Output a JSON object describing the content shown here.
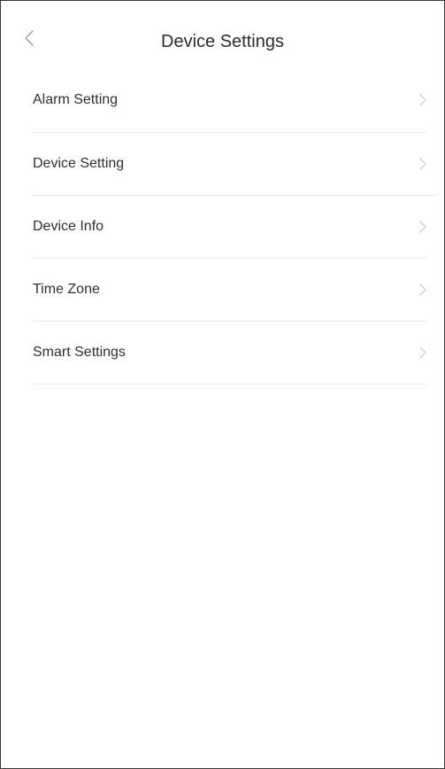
{
  "header": {
    "back_icon": "chevron-left-icon",
    "title": "Device Settings"
  },
  "settings": {
    "items": [
      {
        "label": "Alarm Setting",
        "icon": "chevron-right-icon"
      },
      {
        "label": "Device Setting",
        "icon": "chevron-right-icon"
      },
      {
        "label": "Device Info",
        "icon": "chevron-right-icon"
      },
      {
        "label": "Time Zone",
        "icon": "chevron-right-icon"
      },
      {
        "label": "Smart Settings",
        "icon": "chevron-right-icon"
      }
    ]
  },
  "colors": {
    "background": "#ffffff",
    "text": "#2f2f2f",
    "divider": "#ececec",
    "chevron": "#c8c8c8",
    "frame_border": "#3a3a3a"
  }
}
